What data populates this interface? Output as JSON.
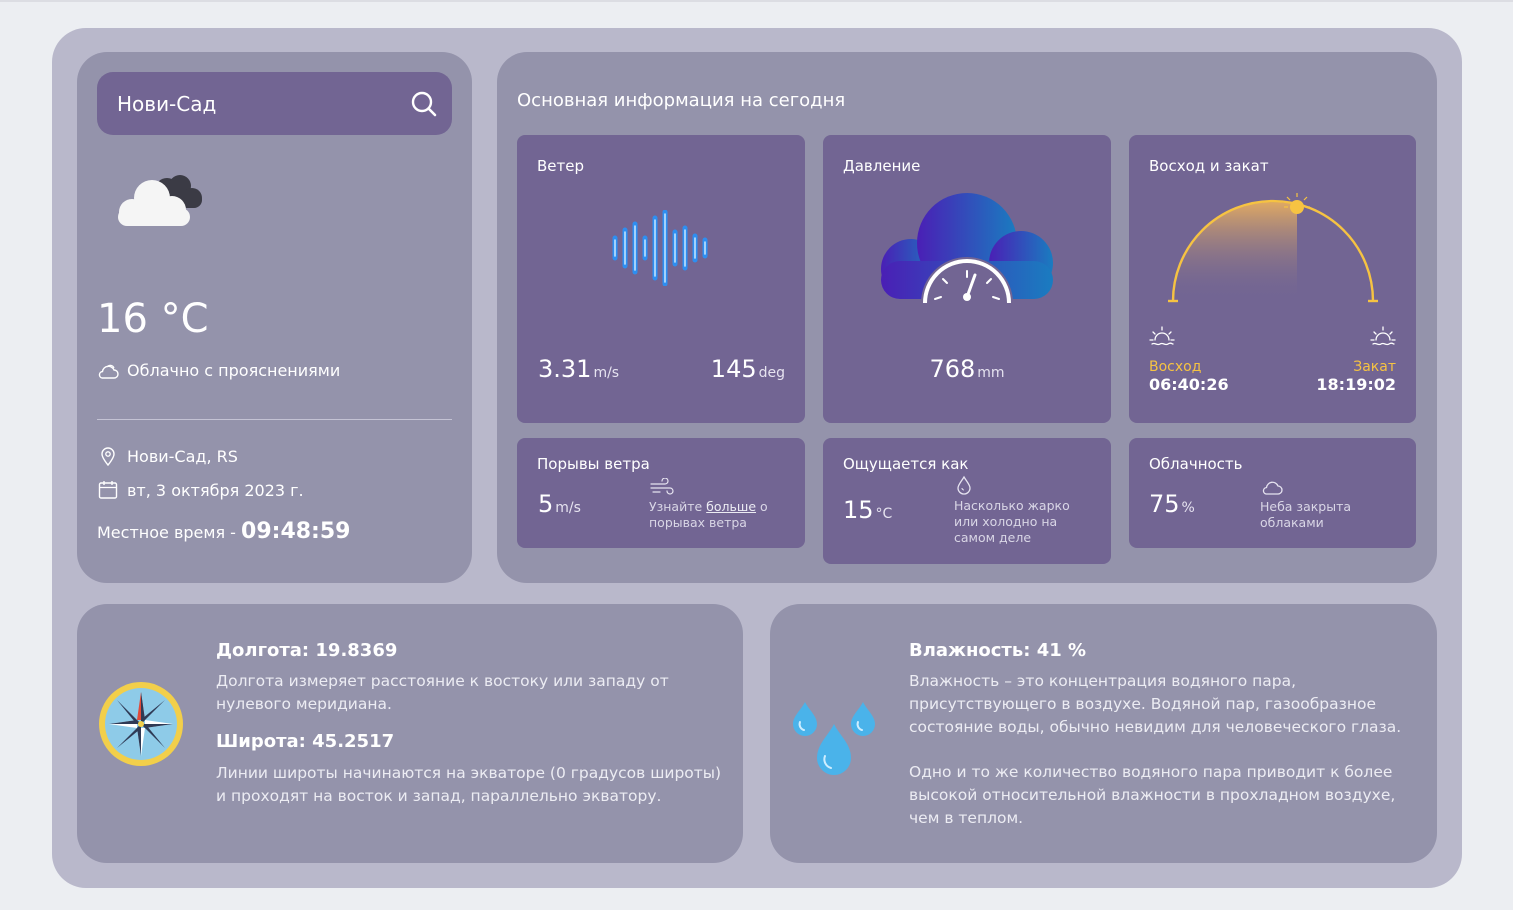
{
  "search": {
    "value": "Нови-Сад"
  },
  "current": {
    "temperature": "16 °C",
    "condition": "Облачно с прояснениями",
    "location": "Нови-Сад, RS",
    "date": "вт, 3 октября 2023 г.",
    "local_time_label": "Местное время -",
    "local_time": "09:48:59"
  },
  "today": {
    "title": "Основная информация на сегодня",
    "wind": {
      "title": "Ветер",
      "speed": "3.31",
      "speed_unit": "m/s",
      "deg": "145",
      "deg_unit": "deg"
    },
    "pressure": {
      "title": "Давление",
      "value": "768",
      "unit": "mm"
    },
    "sun": {
      "title": "Восход и закат",
      "sunrise_label": "Восход",
      "sunrise": "06:40:26",
      "sunset_label": "Закат",
      "sunset": "18:19:02"
    },
    "gust": {
      "title": "Порывы ветра",
      "value": "5",
      "unit": "m/s",
      "note_prefix": "Узнайте ",
      "note_link": "больше",
      "note_suffix": " о порывах ветра"
    },
    "feels": {
      "title": "Ощущается как",
      "value": "15",
      "unit": "°C",
      "note": "Насколько жарко или холодно на самом деле"
    },
    "clouds": {
      "title": "Облачность",
      "value": "75",
      "unit": "%",
      "note": "Неба закрыта облаками"
    }
  },
  "coords": {
    "lon_title": "Долгота: 19.8369",
    "lon_text": "Долгота измеряет расстояние к востоку или западу от нулевого меридиана.",
    "lat_title": "Широта: 45.2517",
    "lat_text": "Линии широты начинаются на экваторе (0 градусов широты) и проходят на восток и запад, параллельно экватору."
  },
  "humidity": {
    "title": "Влажность: 41 %",
    "text1": "Влажность – это концентрация водяного пара, присутствующего в воздухе. Водяной пар, газообразное состояние воды, обычно невидим для человеческого глаза.",
    "text2": "Одно и то же количество водяного пара приводит к более высокой относительной влажности в прохладном воздухе, чем в теплом."
  },
  "icons": {
    "search": "search-icon",
    "weather": "cloud-icon",
    "condition": "cloud-outline-icon",
    "location": "map-pin-icon",
    "calendar": "calendar-icon",
    "wind": "sound-wave-icon",
    "pressure": "pressure-gauge-icon",
    "sunrise": "sunrise-icon",
    "sunset": "sunset-icon",
    "gust": "wind-icon",
    "feels": "drop-icon",
    "clouds": "cloud-outline-icon",
    "compass": "compass-icon",
    "humidity": "water-drops-icon"
  },
  "colors": {
    "accent": "#726593",
    "panel": "#9493ab",
    "outer": "#b9b8cb",
    "sun": "#f6c342"
  }
}
